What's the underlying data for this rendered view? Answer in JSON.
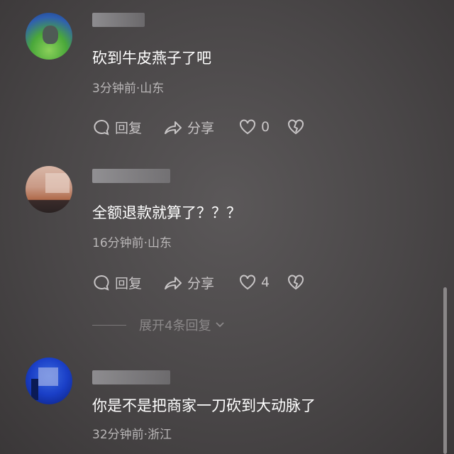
{
  "comments": [
    {
      "text": "砍到牛皮燕子了吧",
      "meta": "3分钟前·山东",
      "reply_label": "回复",
      "share_label": "分享",
      "like_count": "0"
    },
    {
      "text": "全额退款就算了？？？",
      "meta": "16分钟前·山东",
      "reply_label": "回复",
      "share_label": "分享",
      "like_count": "4",
      "expand_label": "展开4条回复"
    },
    {
      "text": "你是不是把商家一刀砍到大动脉了",
      "meta": "32分钟前·浙江"
    }
  ],
  "icons": {
    "reply": "comment-bubble-icon",
    "share": "share-arrow-icon",
    "like": "heart-icon",
    "dislike": "broken-heart-icon",
    "expand": "chevron-down-icon"
  },
  "colors": {
    "background": "#4a4748",
    "text": "#ffffff",
    "meta": "#b9b6b7",
    "action": "#c8c5c6",
    "expand": "#8c898a"
  }
}
